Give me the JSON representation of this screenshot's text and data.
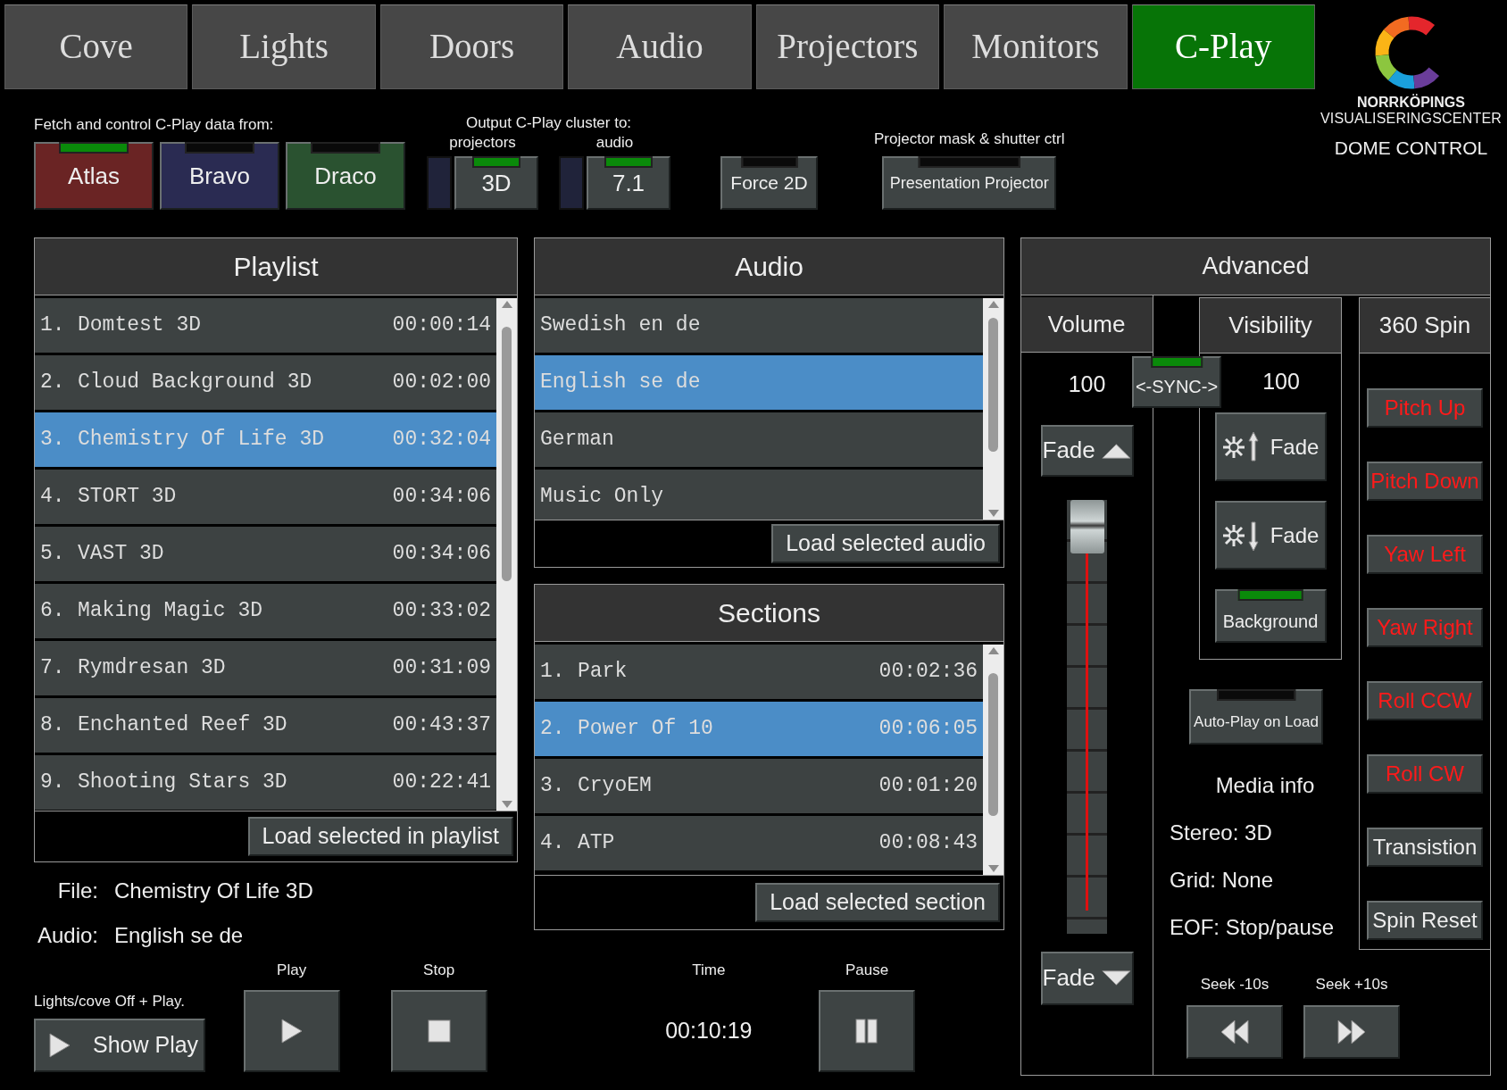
{
  "tabs": [
    {
      "label": "Cove",
      "selected": false
    },
    {
      "label": "Lights",
      "selected": false
    },
    {
      "label": "Doors",
      "selected": false
    },
    {
      "label": "Audio",
      "selected": false
    },
    {
      "label": "Projectors",
      "selected": false
    },
    {
      "label": "Monitors",
      "selected": false
    },
    {
      "label": "C-Play",
      "selected": true
    }
  ],
  "logo": {
    "line1": "NORRKÖPINGS",
    "line2": "VISUALISERINGSCENTER",
    "subtitle": "DOME CONTROL"
  },
  "sources": {
    "label": "Fetch and control C-Play data from:",
    "buttons": [
      {
        "label": "Atlas",
        "color": "#6a2424",
        "on": true
      },
      {
        "label": "Bravo",
        "color": "#2a2b52",
        "on": false
      },
      {
        "label": "Draco",
        "color": "#2a5230",
        "on": false
      }
    ]
  },
  "output": {
    "label": "Output C-Play cluster to:",
    "groups": [
      {
        "label": "projectors",
        "button": "3D",
        "on": true
      },
      {
        "label": "audio",
        "button": "7.1",
        "on": true
      }
    ]
  },
  "force_2d": {
    "label": "Force 2D",
    "on": false
  },
  "mask": {
    "label": "Projector mask & shutter ctrl",
    "button": "Presentation Projector",
    "on": false
  },
  "playlist": {
    "title": "Playlist",
    "button": "Load selected in playlist",
    "items": [
      {
        "number": "1.",
        "title": "Domtest 3D",
        "time": "00:00:14",
        "selected": false
      },
      {
        "number": "2.",
        "title": "Cloud Background 3D",
        "time": "00:02:00",
        "selected": false
      },
      {
        "number": "3.",
        "title": "Chemistry Of Life 3D",
        "time": "00:32:04",
        "selected": true
      },
      {
        "number": "4.",
        "title": "STORT 3D",
        "time": "00:34:06",
        "selected": false
      },
      {
        "number": "5.",
        "title": "VAST 3D",
        "time": "00:34:06",
        "selected": false
      },
      {
        "number": "6.",
        "title": "Making Magic 3D",
        "time": "00:33:02",
        "selected": false
      },
      {
        "number": "7.",
        "title": "Rymdresan 3D",
        "time": "00:31:09",
        "selected": false
      },
      {
        "number": "8.",
        "title": "Enchanted Reef 3D",
        "time": "00:43:37",
        "selected": false
      },
      {
        "number": "9.",
        "title": "Shooting Stars 3D",
        "time": "00:22:41",
        "selected": false
      }
    ]
  },
  "audio": {
    "title": "Audio",
    "button": "Load selected audio",
    "items": [
      {
        "label": "Swedish en de",
        "selected": false
      },
      {
        "label": "English se de",
        "selected": true
      },
      {
        "label": "German",
        "selected": false
      },
      {
        "label": "Music Only",
        "selected": false
      }
    ]
  },
  "sections": {
    "title": "Sections",
    "button": "Load selected section",
    "items": [
      {
        "number": "1.",
        "title": "Park",
        "time": "00:02:36",
        "selected": false
      },
      {
        "number": "2.",
        "title": "Power Of 10",
        "time": "00:06:05",
        "selected": true
      },
      {
        "number": "3.",
        "title": "CryoEM",
        "time": "00:01:20",
        "selected": false
      },
      {
        "number": "4.",
        "title": "ATP",
        "time": "00:08:43",
        "selected": false
      }
    ]
  },
  "file_info": [
    {
      "label": "File:",
      "value": "Chemistry Of Life 3D"
    },
    {
      "label": "Audio:",
      "value": "English se de"
    }
  ],
  "show_play": {
    "caption": "Lights/cove Off + Play.",
    "button": "Show Play"
  },
  "transport": [
    {
      "kind": "play",
      "caption": "Play"
    },
    {
      "kind": "stop",
      "caption": "Stop"
    },
    {
      "kind": "time",
      "caption": "Time",
      "value": "00:10:19"
    },
    {
      "kind": "pause",
      "caption": "Pause"
    }
  ],
  "advanced": {
    "title": "Advanced",
    "volume": {
      "title": "Volume",
      "value": "100",
      "fade_up": "Fade",
      "fade_down": "Fade",
      "level": 1.0
    },
    "sync": {
      "label": "<-SYNC->",
      "on": true
    },
    "visibility": {
      "title": "Visibility",
      "value": "100",
      "fade_in": "Fade",
      "fade_out": "Fade",
      "background": {
        "label": "Background",
        "on": true
      }
    },
    "autoplay": {
      "label": "Auto-Play on Load",
      "on": false
    },
    "media_info": {
      "title": "Media info",
      "lines": [
        "Stereo:  3D",
        "Grid: None",
        "EOF: Stop/pause"
      ]
    },
    "seek": [
      {
        "kind": "back",
        "caption": "Seek -10s"
      },
      {
        "kind": "forward",
        "caption": "Seek +10s"
      }
    ],
    "spin": {
      "title": "360 Spin",
      "buttons": [
        {
          "label": "Pitch Up",
          "kind": "motion"
        },
        {
          "label": "Pitch Down",
          "kind": "motion"
        },
        {
          "label": "Yaw Left",
          "kind": "motion"
        },
        {
          "label": "Yaw Right",
          "kind": "motion"
        },
        {
          "label": "Roll CCW",
          "kind": "motion"
        },
        {
          "label": "Roll CW",
          "kind": "motion"
        },
        {
          "label": "Transistion",
          "kind": "action"
        },
        {
          "label": "Spin Reset",
          "kind": "action"
        }
      ]
    }
  }
}
